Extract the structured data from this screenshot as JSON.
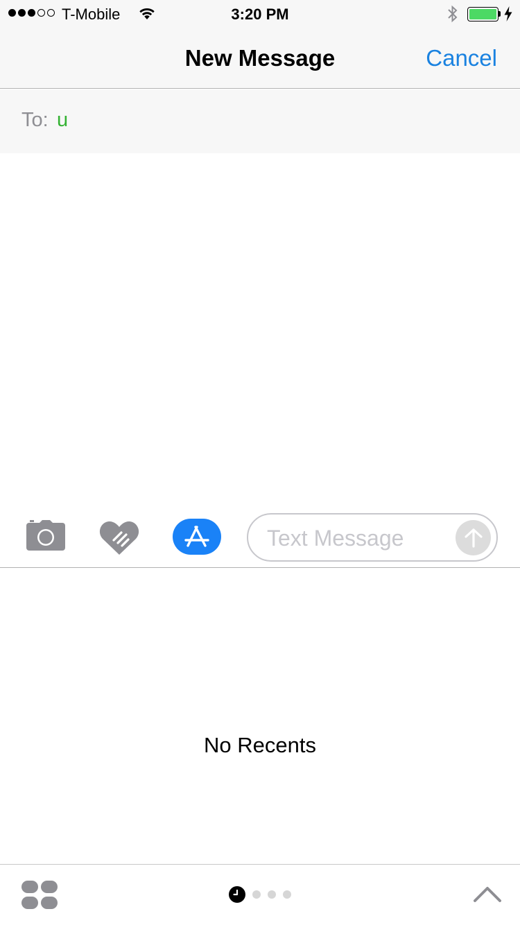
{
  "status_bar": {
    "carrier": "T-Mobile",
    "time": "3:20 PM",
    "signal_strength": 3,
    "signal_max": 5,
    "battery_percent": 100,
    "battery_color": "#4cd964",
    "icons": [
      "signal-icon",
      "wifi-icon",
      "bluetooth-icon",
      "battery-icon",
      "charging-bolt-icon"
    ]
  },
  "nav": {
    "title": "New Message",
    "cancel_label": "Cancel",
    "accent_color": "#1a82e0"
  },
  "to_field": {
    "label": "To:",
    "value": "u",
    "value_color": "#34b233"
  },
  "compose": {
    "icons": [
      "camera-icon",
      "digital-touch-icon",
      "app-store-icon",
      "send-arrow-icon"
    ],
    "placeholder": "Text Message",
    "app_store_color": "#1a82f7"
  },
  "drawer": {
    "empty_text": "No Recents",
    "page_count": 4,
    "current_page": 0,
    "icons": [
      "app-drawer-icon",
      "recents-clock-icon",
      "chevron-up-icon"
    ]
  }
}
